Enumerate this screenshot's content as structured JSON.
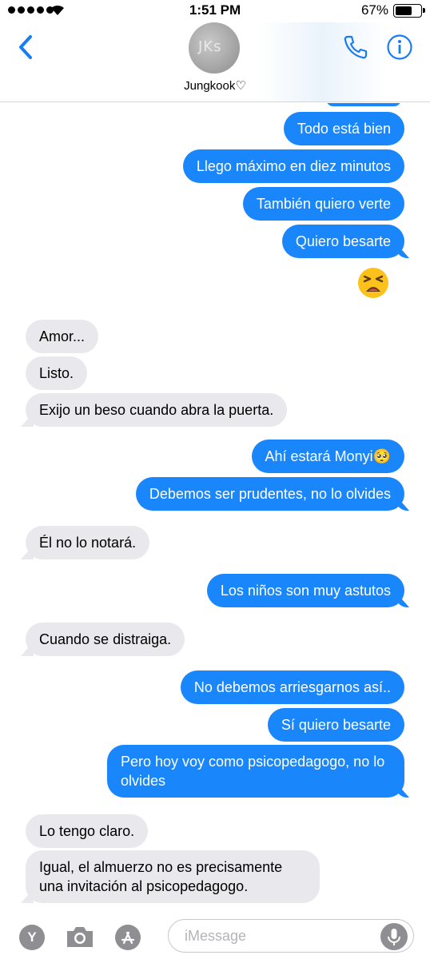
{
  "status": {
    "time": "1:51 PM",
    "battery": "67%",
    "battery_level": 0.67
  },
  "header": {
    "contact_name": "Jungkook♡",
    "avatar_text": "JKs"
  },
  "messages": [
    {
      "side": "sent",
      "text": "Todo está bien"
    },
    {
      "side": "sent",
      "text": "Llego máximo en diez minutos"
    },
    {
      "side": "sent",
      "text": "También quiero verte"
    },
    {
      "side": "sent",
      "text": "Quiero besarte"
    },
    {
      "side": "sent",
      "emoji": "tired-face-emoji"
    },
    {
      "side": "received",
      "text": "Amor..."
    },
    {
      "side": "received",
      "text": "Listo."
    },
    {
      "side": "received",
      "text": "Exijo un beso cuando abra la puerta."
    },
    {
      "side": "sent",
      "text": "Ahí estará Monyi🥺"
    },
    {
      "side": "sent",
      "text": "Debemos ser prudentes, no lo olvides"
    },
    {
      "side": "received",
      "text": "Él no lo notará."
    },
    {
      "side": "sent",
      "text": "Los niños son muy astutos"
    },
    {
      "side": "received",
      "text": "Cuando se distraiga."
    },
    {
      "side": "sent",
      "text": "No debemos arriesgarnos así.."
    },
    {
      "side": "sent",
      "text": "Sí quiero besarte"
    },
    {
      "side": "sent",
      "text": "Pero hoy voy como psicopedagogo, no lo olvides"
    },
    {
      "side": "received",
      "text": "Lo tengo claro."
    },
    {
      "side": "received",
      "text": "Igual, el almuerzo no es precisamente una invitación al psicopedagogo."
    }
  ],
  "input": {
    "placeholder": "iMessage",
    "app_button_label": "Y"
  },
  "colors": {
    "sent_bubble": "#1a86fb",
    "received_bubble": "#e8e8ed",
    "accent": "#1a7cf5"
  }
}
